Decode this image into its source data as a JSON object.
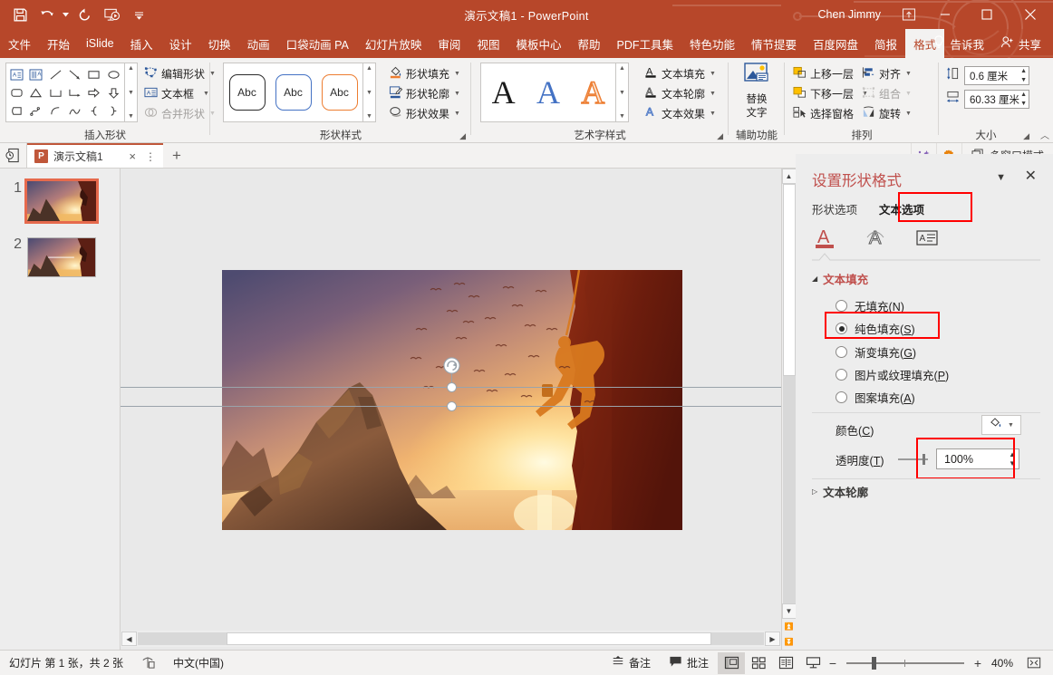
{
  "titlebar": {
    "doc_title": "演示文稿1  -  PowerPoint",
    "user_name": "Chen Jimmy",
    "qat": [
      {
        "name": "save-icon",
        "label": "保存"
      },
      {
        "name": "undo-icon",
        "label": "撤消"
      },
      {
        "name": "redo-icon",
        "label": "恢复"
      },
      {
        "name": "start-slideshow-icon",
        "label": "从头开始"
      },
      {
        "name": "customize-qat-icon",
        "label": "自定义快速访问工具栏"
      }
    ],
    "window": {
      "ribbon_display_options": "功能区显示选项",
      "minimize": "最小化",
      "maximize": "最大化",
      "close": "关闭"
    }
  },
  "ribbon_tabs": [
    {
      "label": "文件",
      "active": false
    },
    {
      "label": "开始",
      "active": false
    },
    {
      "label": "iSlide",
      "active": false
    },
    {
      "label": "插入",
      "active": false
    },
    {
      "label": "设计",
      "active": false
    },
    {
      "label": "切换",
      "active": false
    },
    {
      "label": "动画",
      "active": false
    },
    {
      "label": "口袋动画 PA",
      "active": false
    },
    {
      "label": "幻灯片放映",
      "active": false
    },
    {
      "label": "审阅",
      "active": false
    },
    {
      "label": "视图",
      "active": false
    },
    {
      "label": "模板中心",
      "active": false
    },
    {
      "label": "帮助",
      "active": false
    },
    {
      "label": "PDF工具集",
      "active": false
    },
    {
      "label": "特色功能",
      "active": false
    },
    {
      "label": "情节提要",
      "active": false
    },
    {
      "label": "百度网盘",
      "active": false
    },
    {
      "label": "简报",
      "active": false
    },
    {
      "label": "格式",
      "active": true
    }
  ],
  "ribbon_tabs_right": [
    {
      "label": "告诉我",
      "icon": "lightbulb-icon"
    },
    {
      "label": "共享",
      "icon": "share-person-icon"
    }
  ],
  "ribbon": {
    "groups": [
      {
        "name": "insert-shapes",
        "label": "插入形状",
        "buttons": [
          {
            "label": "编辑形状",
            "icon": "edit-shape-icon",
            "disabled": false,
            "dropdown": true
          },
          {
            "label": "文本框",
            "icon": "textbox-icon",
            "disabled": false,
            "dropdown": true
          },
          {
            "label": "合并形状",
            "icon": "merge-shapes-icon",
            "disabled": true,
            "dropdown": true
          }
        ]
      },
      {
        "name": "shape-styles",
        "label": "形状样式",
        "gallery": [
          "Abc",
          "Abc",
          "Abc"
        ],
        "buttons": [
          {
            "label": "形状填充",
            "icon": "shape-fill-icon",
            "dropdown": true
          },
          {
            "label": "形状轮廓",
            "icon": "shape-outline-icon",
            "dropdown": true
          },
          {
            "label": "形状效果",
            "icon": "shape-effects-icon",
            "dropdown": true
          }
        ]
      },
      {
        "name": "wordart-styles",
        "label": "艺术字样式",
        "gallery": [
          "A",
          "A",
          "A"
        ],
        "buttons": [
          {
            "label": "文本填充",
            "icon": "text-fill-icon",
            "dropdown": true
          },
          {
            "label": "文本轮廓",
            "icon": "text-outline-icon",
            "dropdown": true
          },
          {
            "label": "文本效果",
            "icon": "text-effects-icon",
            "dropdown": true
          }
        ]
      },
      {
        "name": "accessibility",
        "label": "辅助功能",
        "buttons": [
          {
            "label": "替换\n文字",
            "label_line1": "替换",
            "label_line2": "文字",
            "icon": "alt-text-icon"
          }
        ]
      },
      {
        "name": "arrange",
        "label": "排列",
        "buttons": [
          {
            "label": "上移一层",
            "icon": "bring-forward-icon",
            "dropdown": true
          },
          {
            "label": "下移一层",
            "icon": "send-backward-icon",
            "dropdown": true
          },
          {
            "label": "选择窗格",
            "icon": "selection-pane-icon",
            "dropdown": false
          },
          {
            "label": "对齐",
            "icon": "align-icon",
            "dropdown": true
          },
          {
            "label": "组合",
            "icon": "group-icon",
            "dropdown": true,
            "disabled": true
          },
          {
            "label": "旋转",
            "icon": "rotate-icon",
            "dropdown": true
          }
        ]
      },
      {
        "name": "size",
        "label": "大小",
        "height": {
          "icon": "shape-height-icon",
          "value": "0.6 厘米"
        },
        "width": {
          "icon": "shape-width-icon",
          "value": "60.33 厘米"
        }
      }
    ]
  },
  "doc_strip": {
    "tab_label": "演示文稿1",
    "pp_letter": "P",
    "close_label": "×",
    "more_label": "⋮",
    "new_tab": "+",
    "right_buttons": [
      {
        "name": "magic-wand-icon",
        "label": "魔术棒"
      },
      {
        "name": "gear-icon",
        "label": "设置"
      }
    ],
    "multiwindow_label": "多窗口模式"
  },
  "thumbnails": [
    {
      "number": "1",
      "selected": true
    },
    {
      "number": "2",
      "selected": false
    }
  ],
  "format_pane": {
    "title": "设置形状格式",
    "collapse_icon": "chevron-down-icon",
    "close_icon": "close-icon",
    "tabs": [
      {
        "label": "形状选项",
        "selected": false
      },
      {
        "label": "文本选项",
        "selected": true,
        "highlighted": true
      }
    ],
    "icon_tabs": [
      {
        "name": "text-fill-outline-icon",
        "selected": true
      },
      {
        "name": "text-effects-icon",
        "selected": false
      },
      {
        "name": "textbox-layout-icon",
        "selected": false
      }
    ],
    "section_title": "文本填充",
    "radio_options": [
      {
        "label": "无填充",
        "accel": "N",
        "selected": false,
        "highlighted": false
      },
      {
        "label": "纯色填充",
        "accel": "S",
        "selected": true,
        "highlighted": true
      },
      {
        "label": "渐变填充",
        "accel": "G",
        "selected": false,
        "highlighted": false
      },
      {
        "label": "图片或纹理填充",
        "accel": "P",
        "selected": false,
        "highlighted": false
      },
      {
        "label": "图案填充",
        "accel": "A",
        "selected": false,
        "highlighted": false
      }
    ],
    "color_row": {
      "label": "颜色",
      "accel": "C",
      "button_icon": "fill-color-icon"
    },
    "transparency_row": {
      "label": "透明度",
      "accel": "T",
      "value": "100%",
      "highlighted": true
    },
    "collapsed_section": {
      "label": "文本轮廓",
      "expand_icon": "triangle-right-icon"
    }
  },
  "statusbar": {
    "slide_info": "幻灯片 第 1 张，共 2 张",
    "accessibility_icon": "accessibility-check-icon",
    "language": "中文(中国)",
    "notes_label": "备注",
    "comments_label": "批注",
    "views": [
      {
        "name": "normal-view-icon",
        "active": true
      },
      {
        "name": "slide-sorter-view-icon",
        "active": false
      },
      {
        "name": "reading-view-icon",
        "active": false
      },
      {
        "name": "slideshow-view-icon",
        "active": false
      }
    ],
    "zoom_out": "−",
    "zoom_in": "+",
    "zoom_value": "40%",
    "fit_icon": "fit-to-window-icon"
  },
  "colors": {
    "brand_red": "#b7472a",
    "pane_bg": "#ededed",
    "highlight_red": "#ff0000",
    "accent_orange": "#ed7d31",
    "accent_blue": "#4472c4"
  }
}
